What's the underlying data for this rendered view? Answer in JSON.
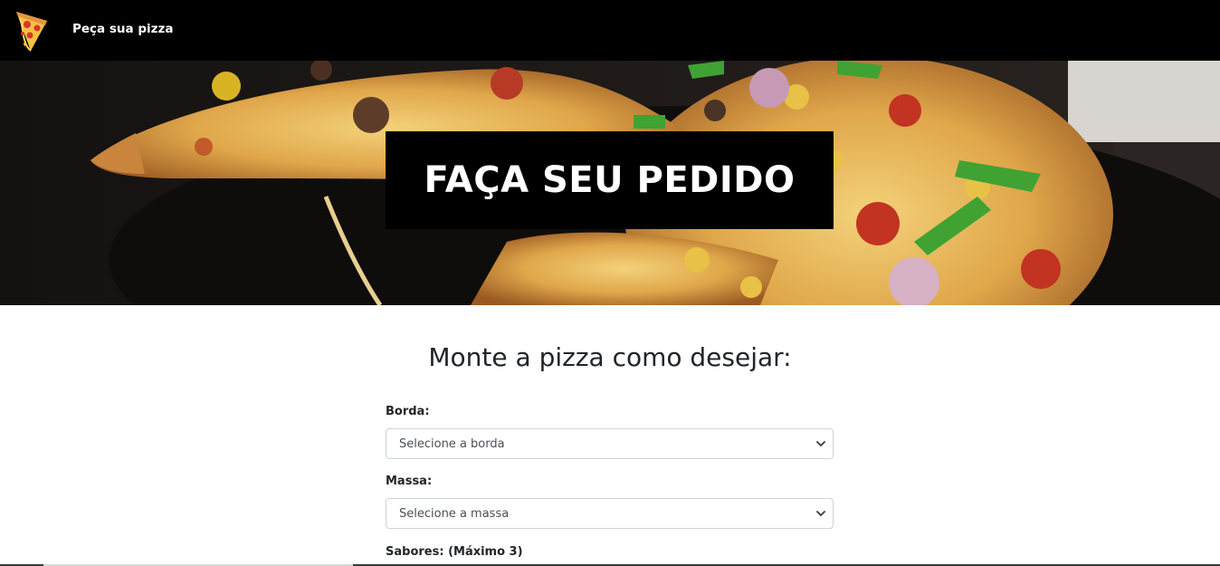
{
  "navbar": {
    "logo_icon": "pizza-slice-icon",
    "brand": "Peça sua pizza"
  },
  "hero": {
    "title": "FAÇA SEU PEDIDO",
    "background": "pizza-photo"
  },
  "form": {
    "title": "Monte a pizza como desejar:",
    "borda": {
      "label": "Borda:",
      "selected": "Selecione a borda"
    },
    "massa": {
      "label": "Massa:",
      "selected": "Selecione a massa"
    },
    "sabores": {
      "label": "Sabores: (Máximo 3)"
    }
  },
  "colors": {
    "navbar_bg": "#000000",
    "hero_box_bg": "#000000",
    "text": "#212529"
  }
}
